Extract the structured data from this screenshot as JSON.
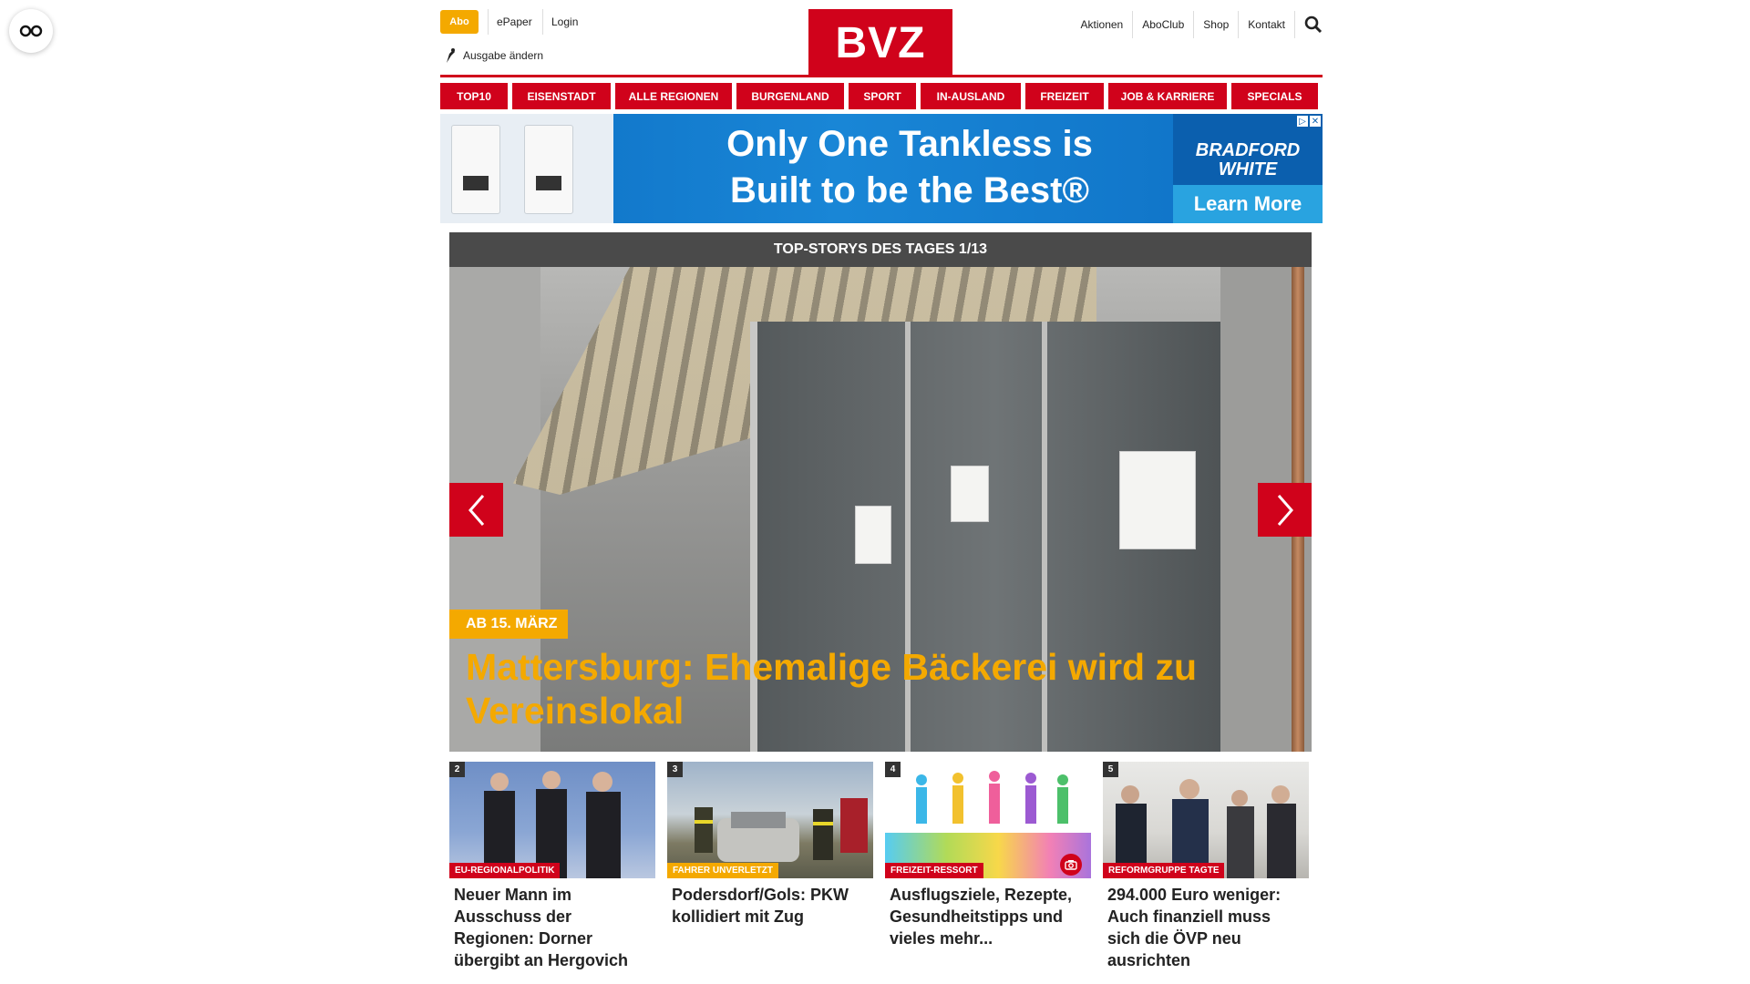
{
  "floating": {
    "icon": "glasses-icon"
  },
  "header": {
    "abo_label": "Abo",
    "epaper_label": "ePaper",
    "login_label": "Login",
    "ausgabe_label": "Ausgabe ändern",
    "logo_text": "BVZ",
    "right_links": [
      "Aktionen",
      "AboClub",
      "Shop",
      "Kontakt"
    ],
    "search_icon": "search-icon"
  },
  "nav": {
    "items": [
      "TOP10",
      "EISENSTADT",
      "ALLE REGIONEN",
      "BURGENLAND",
      "SPORT",
      "IN-AUSLAND",
      "FREIZEIT",
      "JOB & KARRIERE",
      "SPECIALS"
    ]
  },
  "ad": {
    "headline_line1": "Only One Tankless is",
    "headline_line2": "Built to be the Best®",
    "brand_line1": "BRADFORD",
    "brand_line2": "WHITE",
    "cta": "Learn More"
  },
  "slider": {
    "header": "TOP-STORYS DES TAGES 1/13",
    "badge": "AB 15. MÄRZ",
    "title": "Mattersburg: Ehemalige Bäckerei wird zu Vereinslokal"
  },
  "teasers": [
    {
      "num": "2",
      "label": "EU-REGIONALPOLITIK",
      "title": "Neuer Mann im Ausschuss der Regionen: Dorner übergibt an Hergovich"
    },
    {
      "num": "3",
      "label": "FAHRER UNVERLETZT",
      "title": "Podersdorf/Gols: PKW kollidiert mit Zug"
    },
    {
      "num": "4",
      "label": "FREIZEIT-RESSORT",
      "title": "Ausflugsziele, Rezepte, Gesundheitstipps und vieles mehr..."
    },
    {
      "num": "5",
      "label": "REFORMGRUPPE TAGTE",
      "title": "294.000 Euro weniger: Auch finanziell muss sich die ÖVP neu ausrichten"
    }
  ]
}
